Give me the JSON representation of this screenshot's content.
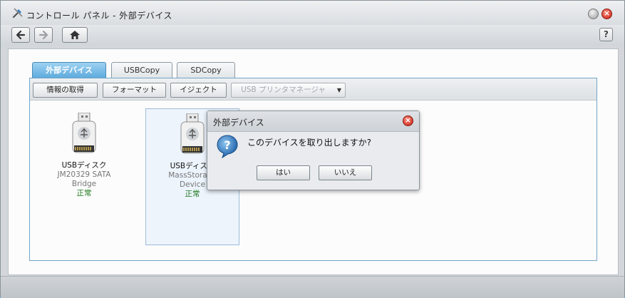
{
  "window": {
    "title": "コントロール パネル - 外部デバイス",
    "icon": "tools-icon",
    "close_label": "×",
    "help_label": "?"
  },
  "tabs": [
    {
      "label": "外部デバイス",
      "active": true
    },
    {
      "label": "USBCopy",
      "active": false
    },
    {
      "label": "SDCopy",
      "active": false
    }
  ],
  "toolbar": {
    "get_info": "情報の取得",
    "format": "フォーマット",
    "eject": "イジェクト",
    "usb_printer_manager": "USB プリンタマネージャ",
    "dropdown_arrow": "▼"
  },
  "devices": [
    {
      "name": "USBディスク",
      "model": "JM20329 SATA",
      "model2": "Bridge",
      "status": "正常"
    },
    {
      "name": "USBディスク",
      "model": "MassStorage",
      "model2": "Device",
      "status": "正常"
    }
  ],
  "dialog": {
    "title": "外部デバイス",
    "close_label": "×",
    "message": "このデバイスを取り出しますか?",
    "yes": "はい",
    "no": "いいえ"
  },
  "colors": {
    "accent": "#5aa9dd",
    "status_ok": "#1f7a1f",
    "close_red": "#c51c10"
  }
}
